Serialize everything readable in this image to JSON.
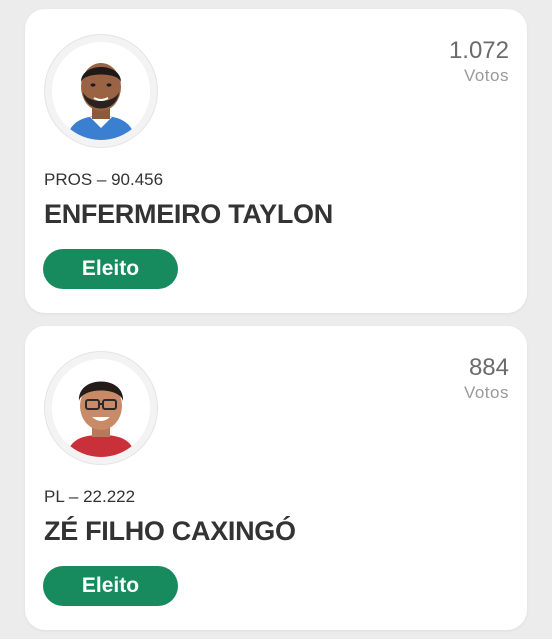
{
  "theme": {
    "accent": "#178a5e",
    "background": "#ececec",
    "card": "#ffffff"
  },
  "candidates": [
    {
      "votes": "1.072",
      "votes_label": "Votos",
      "party": "PROS – 90.456",
      "name": "ENFERMEIRO TAYLON",
      "status": "Eleito",
      "avatar_icon": "candidate-photo"
    },
    {
      "votes": "884",
      "votes_label": "Votos",
      "party": "PL – 22.222",
      "name": "ZÉ FILHO CAXINGÓ",
      "status": "Eleito",
      "avatar_icon": "candidate-photo"
    }
  ]
}
